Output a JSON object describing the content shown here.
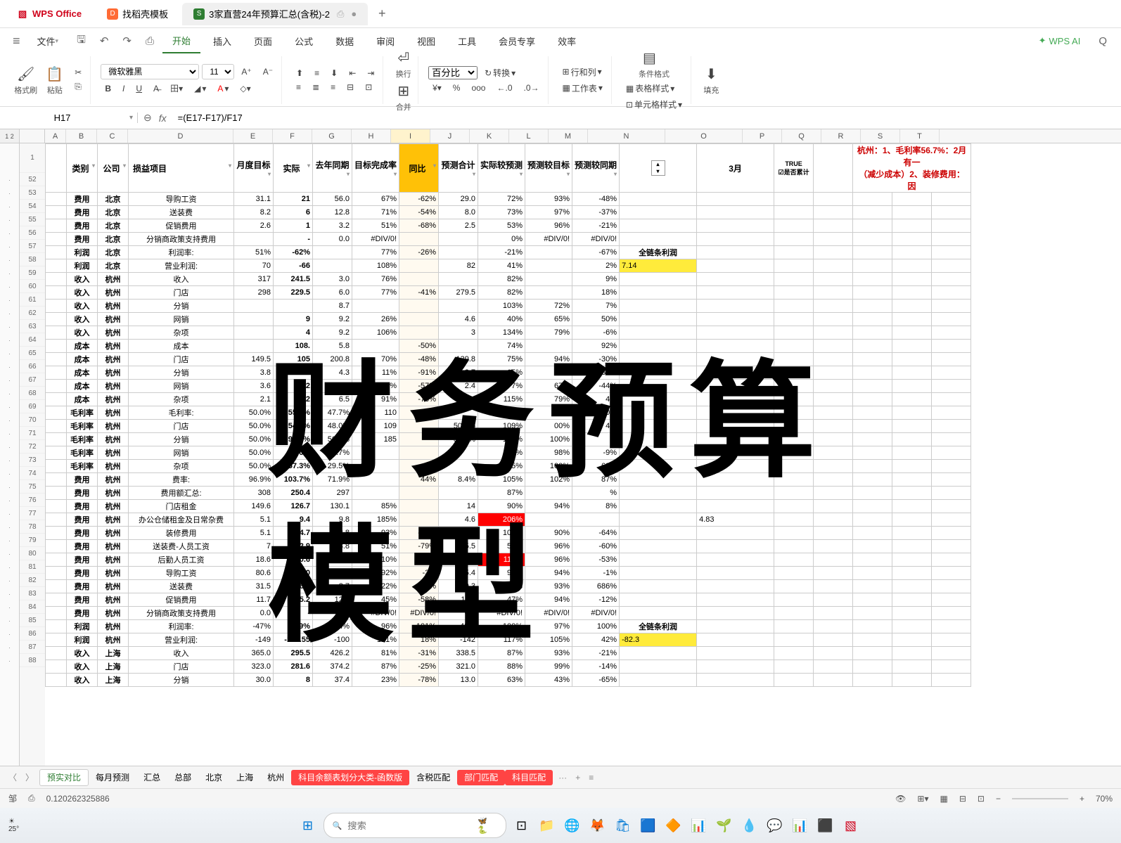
{
  "titlebar": {
    "app": "WPS Office",
    "tabs": [
      "找稻壳模板",
      "3家直营24年预算汇总(含税)-2"
    ],
    "add": "+"
  },
  "menu": {
    "file": "文件",
    "items": [
      "开始",
      "插入",
      "页面",
      "公式",
      "数据",
      "审阅",
      "视图",
      "工具",
      "会员专享",
      "效率"
    ],
    "ai": "WPS AI",
    "search": "Q"
  },
  "ribbon": {
    "format_brush": "格式刷",
    "paste": "粘贴",
    "font": "微软雅黑",
    "size": "11",
    "wrap": "换行",
    "merge": "合并",
    "percent": "百分比",
    "convert": "转换",
    "rowcol": "行和列",
    "worksheet": "工作表",
    "condfmt": "条件格式",
    "tablestyle": "表格样式",
    "cellstyle": "单元格样式",
    "fill": "填充"
  },
  "formula": {
    "name": "H17",
    "fx": "fx",
    "text": "=(E17-F17)/F17"
  },
  "colheaders": [
    "A",
    "B",
    "C",
    "D",
    "E",
    "F",
    "G",
    "H",
    "I",
    "J",
    "K",
    "L",
    "M",
    "N",
    "O",
    "P",
    "Q",
    "R",
    "S",
    "T"
  ],
  "tableHeader": {
    "B": "类别",
    "C": "公司",
    "D": "损益项目",
    "E": "月度目标",
    "F": "实际",
    "G": "去年同期",
    "H": "目标完成率",
    "I": "同比",
    "J": "预测合计",
    "K": "实际较预测",
    "L": "预测较目标",
    "M": "预测较同期"
  },
  "month": "3月",
  "true": "TRUE",
  "chkLabel": "是否累计",
  "note": "杭州：1、毛利率56.7%：2月有一\n（减少成本）2、装修费用：因",
  "rows": [
    {
      "n": 52,
      "B": "费用",
      "C": "北京",
      "D": "导购工资",
      "E": "31.1",
      "F": "21",
      "G": "56.0",
      "H": "67%",
      "I": "-62%",
      "J": "29.0",
      "K": "72%",
      "L": "93%",
      "M": "-48%"
    },
    {
      "n": 53,
      "B": "费用",
      "C": "北京",
      "D": "送装费",
      "E": "8.2",
      "F": "6",
      "G": "12.8",
      "H": "71%",
      "I": "-54%",
      "J": "8.0",
      "K": "73%",
      "L": "97%",
      "M": "-37%"
    },
    {
      "n": 54,
      "B": "费用",
      "C": "北京",
      "D": "促销费用",
      "E": "2.6",
      "F": "1",
      "G": "3.2",
      "H": "51%",
      "I": "-68%",
      "J": "2.5",
      "K": "53%",
      "L": "96%",
      "M": "-21%"
    },
    {
      "n": 55,
      "B": "费用",
      "C": "北京",
      "D": "分销商政策支持费用",
      "E": "",
      "F": "-",
      "G": "0.0",
      "H": "#DIV/0!",
      "I": "",
      "J": "",
      "K": "0%",
      "L": "#DIV/0!",
      "M": "#DIV/0!"
    },
    {
      "n": 56,
      "B": "利润",
      "C": "北京",
      "D": "利润率:",
      "E": "51%",
      "F": "-62%",
      "G": "",
      "H": "77%",
      "I": "-26%",
      "J": "",
      "K": "-21%",
      "L": "",
      "M": "-67%",
      "N": "全链条利润"
    },
    {
      "n": 57,
      "B": "利润",
      "C": "北京",
      "D": "营业利润:",
      "E": "70",
      "F": "-66",
      "G": "",
      "H": "108%",
      "I": "",
      "J": "82",
      "K": "41%",
      "L": "",
      "M": "2%",
      "N": "7.14",
      "Ny": true
    },
    {
      "n": 58,
      "B": "收入",
      "C": "杭州",
      "D": "收入",
      "E": "317",
      "F": "241.5",
      "G": "3.0",
      "H": "76%",
      "I": "",
      "J": "",
      "K": "82%",
      "L": "",
      "M": "9%"
    },
    {
      "n": 59,
      "B": "收入",
      "C": "杭州",
      "D": "门店",
      "E": "298",
      "F": "229.5",
      "G": "6.0",
      "H": "77%",
      "I": "-41%",
      "J": "279.5",
      "K": "82%",
      "L": "",
      "M": "18%"
    },
    {
      "n": 60,
      "B": "收入",
      "C": "杭州",
      "D": "分销",
      "E": "",
      "F": "",
      "G": "8.7",
      "H": "",
      "I": "",
      "J": "",
      "K": "103%",
      "L": "72%",
      "M": "7%"
    },
    {
      "n": 61,
      "B": "收入",
      "C": "杭州",
      "D": "网销",
      "E": "",
      "F": "9",
      "G": "9.2",
      "H": "26%",
      "I": "",
      "J": "4.6",
      "K": "40%",
      "L": "65%",
      "M": "50%"
    },
    {
      "n": 62,
      "B": "收入",
      "C": "杭州",
      "D": "杂项",
      "E": "",
      "F": "4",
      "G": "9.2",
      "H": "106%",
      "I": "",
      "J": "3",
      "K": "134%",
      "L": "79%",
      "M": "-6%"
    },
    {
      "n": 63,
      "B": "成本",
      "C": "杭州",
      "D": "成本",
      "E": "",
      "F": "108.",
      "G": "5.8",
      "H": "",
      "I": "-50%",
      "J": "",
      "K": "74%",
      "L": "",
      "M": "92%"
    },
    {
      "n": 64,
      "B": "成本",
      "C": "杭州",
      "D": "门店",
      "E": "149.5",
      "F": "105",
      "G": "200.8",
      "H": "70%",
      "I": "-48%",
      "J": "139.8",
      "K": "75%",
      "L": "94%",
      "M": "-30%"
    },
    {
      "n": 65,
      "B": "成本",
      "C": "杭州",
      "D": "分销",
      "E": "3.8",
      "F": "0",
      "G": "4.3",
      "H": "11%",
      "I": "-91%",
      "J": "2.7",
      "K": "15%",
      "L": "72%",
      "M": "-37%"
    },
    {
      "n": 66,
      "B": "成本",
      "C": "杭州",
      "D": "网销",
      "E": "3.6",
      "F": "2",
      "G": "4.3",
      "H": "51%",
      "I": "-57%",
      "J": "2.4",
      "K": "77%",
      "L": "67%",
      "M": "-44%"
    },
    {
      "n": 67,
      "B": "成本",
      "C": "杭州",
      "D": "杂项",
      "E": "2.1",
      "F": "2",
      "G": "6.5",
      "H": "91%",
      "I": "-70%",
      "J": "",
      "K": "115%",
      "L": "79%",
      "M": "4%"
    },
    {
      "n": 68,
      "B": "毛利率",
      "C": "杭州",
      "D": "毛利率:",
      "E": "50.0%",
      "F": "55.0%",
      "G": "47.7%",
      "H": "110",
      "I": "",
      "J": "",
      "K": "10%",
      "L": "",
      "M": "00%"
    },
    {
      "n": 69,
      "B": "毛利率",
      "C": "杭州",
      "D": "门店",
      "E": "50.0%",
      "F": "54.5%",
      "G": "48.0%",
      "H": "109",
      "I": "",
      "J": "50.0%",
      "K": "109%",
      "L": "00%",
      "M": "4%"
    },
    {
      "n": 70,
      "B": "毛利率",
      "C": "杭州",
      "D": "分销",
      "E": "50.0%",
      "F": "92.7%",
      "G": "50.4%",
      "H": "185",
      "I": "",
      "J": "50.0%",
      "K": "185%",
      "L": "100%",
      "M": "%"
    },
    {
      "n": 71,
      "B": "毛利率",
      "C": "杭州",
      "D": "网销",
      "E": "50.0%",
      "F": "1.6%",
      "G": "53.7%",
      "H": "",
      "I": "",
      "J": "",
      "K": "3%",
      "L": "98%",
      "M": "-9%"
    },
    {
      "n": 72,
      "B": "毛利率",
      "C": "杭州",
      "D": "杂项",
      "E": "50.0%",
      "F": "57.3%",
      "G": "29.5%",
      "H": "",
      "I": "",
      "J": "",
      "K": "115%",
      "L": "100%",
      "M": "69%"
    },
    {
      "n": 73,
      "B": "费用",
      "C": "杭州",
      "D": "费率:",
      "E": "96.9%",
      "F": "103.7%",
      "G": "71.9%",
      "H": "",
      "I": "44%",
      "J": "8.4%",
      "K": "105%",
      "L": "102%",
      "M": "87%"
    },
    {
      "n": 74,
      "B": "费用",
      "C": "杭州",
      "D": "费用额汇总:",
      "E": "308",
      "F": "250.4",
      "G": "297",
      "H": "",
      "I": "",
      "J": "",
      "K": "87%",
      "L": "",
      "M": "%"
    },
    {
      "n": 75,
      "B": "费用",
      "C": "杭州",
      "D": "门店租金",
      "E": "149.6",
      "F": "126.7",
      "G": "130.1",
      "H": "85%",
      "I": "",
      "J": "14",
      "K": "90%",
      "L": "94%",
      "M": "8%"
    },
    {
      "n": 76,
      "B": "费用",
      "C": "杭州",
      "D": "办公仓储租金及日常杂费",
      "E": "5.1",
      "F": "9.4",
      "G": "9.8",
      "H": "185%",
      "I": "",
      "J": "4.6",
      "K": "206%",
      "L": "",
      "M": "",
      "Kred": true,
      "O": "4.83"
    },
    {
      "n": 77,
      "B": "费用",
      "C": "杭州",
      "D": "装修费用",
      "E": "5.1",
      "F": "4.7",
      "G": "12.8",
      "H": "93%",
      "I": "-63%",
      "J": "4.6",
      "K": "103%",
      "L": "90%",
      "M": "-64%"
    },
    {
      "n": 78,
      "B": "费用",
      "C": "杭州",
      "D": "送装费-人员工资",
      "E": "7",
      "F": "2.9",
      "G": "13.8",
      "H": "51%",
      "I": "-79%",
      "J": "5.5",
      "K": "53%",
      "L": "96%",
      "M": "-60%"
    },
    {
      "n": 79,
      "B": "费用",
      "C": "杭州",
      "D": "后勤人员工资",
      "E": "18.6",
      "F": "20.6",
      "G": "38.4",
      "H": "110%",
      "I": "-46%",
      "J": "18.0",
      "K": "115%",
      "L": "96%",
      "M": "-53%",
      "Kred": true
    },
    {
      "n": 80,
      "B": "费用",
      "C": "杭州",
      "D": "导购工资",
      "E": "80.6",
      "F": "74.0",
      "G": "75.9",
      "H": "92%",
      "I": "-3%",
      "J": "75.4",
      "K": "98%",
      "L": "94%",
      "M": "-1%"
    },
    {
      "n": 81,
      "B": "费用",
      "C": "杭州",
      "D": "送装费",
      "E": "31.5",
      "F": "6.8",
      "G": "3.7",
      "H": "22%",
      "I": "83%",
      "J": "29.3",
      "K": "23%",
      "L": "93%",
      "M": "686%"
    },
    {
      "n": 82,
      "B": "费用",
      "C": "杭州",
      "D": "促销费用",
      "E": "11.7",
      "F": "5.2",
      "G": "12.5",
      "H": "45%",
      "I": "-58%",
      "J": "11.0",
      "K": "47%",
      "L": "94%",
      "M": "-12%"
    },
    {
      "n": 83,
      "B": "费用",
      "C": "杭州",
      "D": "分销商政策支持费用",
      "E": "0.0",
      "F": "-",
      "G": "0.0",
      "H": "#DIV/0!",
      "I": "#DIV/0!",
      "J": "0.0",
      "K": "#DIV/0!",
      "L": "#DIV/0!",
      "M": "#DIV/0!"
    },
    {
      "n": 84,
      "B": "利润",
      "C": "杭州",
      "D": "利润率:",
      "E": "-47%",
      "F": "-49%",
      "G": "-24%",
      "H": "96%",
      "I": "101%",
      "J": "-48%",
      "K": "100%",
      "L": "97%",
      "M": "100%",
      "N": "全链条利润"
    },
    {
      "n": 85,
      "B": "利润",
      "C": "杭州",
      "D": "营业利润:",
      "E": "-149",
      "F": "-117.55",
      "G": "-100",
      "H": "121%",
      "I": "18%",
      "J": "-142",
      "K": "117%",
      "L": "105%",
      "M": "42%",
      "N": "-82.3",
      "Ny": true
    },
    {
      "n": 86,
      "B": "收入",
      "C": "上海",
      "D": "收入",
      "E": "365.0",
      "F": "295.5",
      "G": "426.2",
      "H": "81%",
      "I": "-31%",
      "J": "338.5",
      "K": "87%",
      "L": "93%",
      "M": "-21%"
    },
    {
      "n": 87,
      "B": "收入",
      "C": "上海",
      "D": "门店",
      "E": "323.0",
      "F": "281.6",
      "G": "374.2",
      "H": "87%",
      "I": "-25%",
      "J": "321.0",
      "K": "88%",
      "L": "99%",
      "M": "-14%"
    },
    {
      "n": 88,
      "B": "收入",
      "C": "上海",
      "D": "分销",
      "E": "30.0",
      "F": "8",
      "G": "37.4",
      "H": "23%",
      "I": "-78%",
      "J": "13.0",
      "K": "63%",
      "L": "43%",
      "M": "-65%"
    }
  ],
  "sheets": {
    "nav": [
      "〈",
      "〉"
    ],
    "tabs": [
      {
        "t": "预实对比",
        "a": true
      },
      {
        "t": "每月预测"
      },
      {
        "t": "汇总"
      },
      {
        "t": "总部"
      },
      {
        "t": "北京"
      },
      {
        "t": "上海"
      },
      {
        "t": "杭州"
      },
      {
        "t": "科目余额表划分大类-函数版",
        "r": true
      },
      {
        "t": "含税匹配"
      },
      {
        "t": "部门匹配",
        "r": true
      },
      {
        "t": "科目匹配",
        "r": true
      }
    ],
    "more": "···",
    "add": "+"
  },
  "status": {
    "l1": "邹",
    "l2": "⎙",
    "val": "0.120262325886",
    "zoom": "70%"
  },
  "taskbar": {
    "temp": "25°",
    "search_ph": "搜索"
  },
  "watermark": "财务预算\n模型"
}
